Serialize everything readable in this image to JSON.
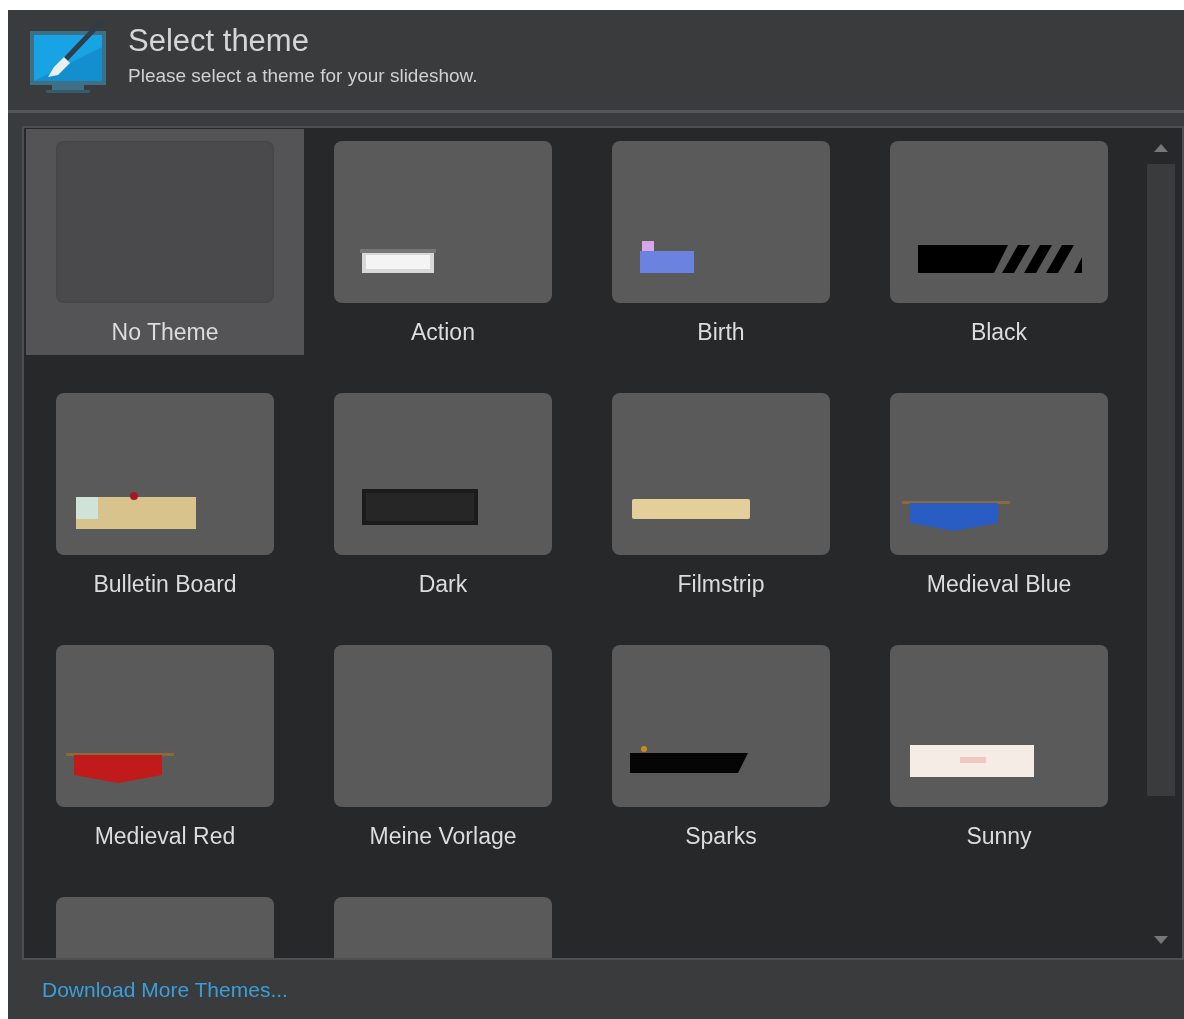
{
  "header": {
    "title": "Select theme",
    "subtitle": "Please select a theme for your slideshow."
  },
  "themes": [
    {
      "label": "No Theme",
      "kind": "none",
      "selected": true
    },
    {
      "label": "Action",
      "kind": "action",
      "selected": false
    },
    {
      "label": "Birth",
      "kind": "birth",
      "selected": false
    },
    {
      "label": "Black",
      "kind": "black",
      "selected": false
    },
    {
      "label": "Bulletin Board",
      "kind": "bulletin",
      "selected": false
    },
    {
      "label": "Dark",
      "kind": "dark",
      "selected": false
    },
    {
      "label": "Filmstrip",
      "kind": "filmstrip",
      "selected": false
    },
    {
      "label": "Medieval Blue",
      "kind": "medieval-blue",
      "selected": false
    },
    {
      "label": "Medieval Red",
      "kind": "medieval-red",
      "selected": false
    },
    {
      "label": "Meine Vorlage",
      "kind": "blank",
      "selected": false
    },
    {
      "label": "Sparks",
      "kind": "sparks",
      "selected": false
    },
    {
      "label": "Sunny",
      "kind": "sunny",
      "selected": false
    },
    {
      "kind": "blank",
      "selected": false
    },
    {
      "kind": "blank",
      "selected": false
    }
  ],
  "footer": {
    "link": "Download More Themes..."
  }
}
